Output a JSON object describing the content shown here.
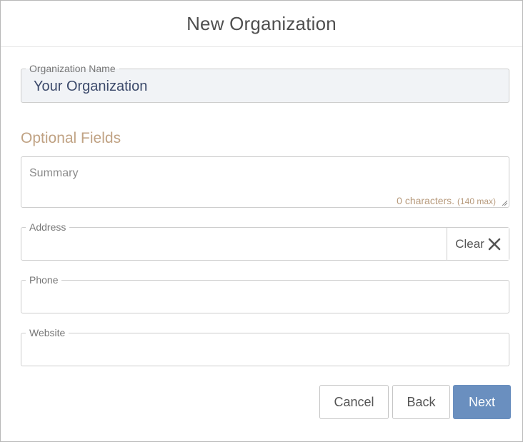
{
  "dialog": {
    "title": "New Organization"
  },
  "organization_name": {
    "label": "Organization Name",
    "value": "Your Organization"
  },
  "optional_section": {
    "title": "Optional Fields"
  },
  "summary": {
    "placeholder": "Summary",
    "char_count": "0 characters.",
    "char_max": "(140 max)"
  },
  "address": {
    "label": "Address",
    "value": "",
    "clear_label": "Clear",
    "clear_icon": "close-icon"
  },
  "phone": {
    "label": "Phone",
    "value": ""
  },
  "website": {
    "label": "Website",
    "value": ""
  },
  "buttons": {
    "cancel": "Cancel",
    "back": "Back",
    "next": "Next"
  },
  "colors": {
    "primary_button": "#6a8fbf",
    "section_title": "#c0a283",
    "char_count": "#b79a7c",
    "org_field_bg": "#f1f3f6"
  }
}
